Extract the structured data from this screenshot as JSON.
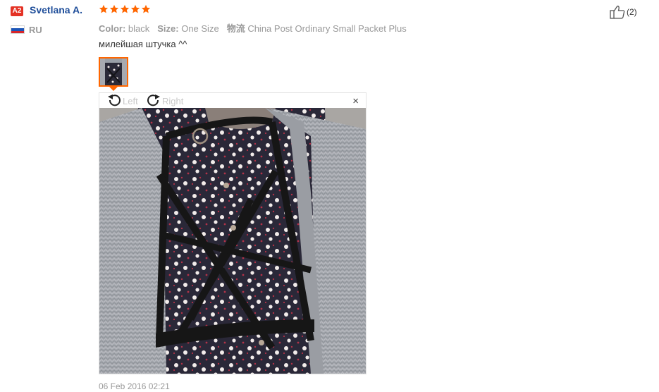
{
  "user": {
    "level_badge": "A2",
    "name": "Svetlana A.",
    "country_code": "RU",
    "flag_colors": [
      "#ffffff",
      "#1c56b8",
      "#d7262b"
    ]
  },
  "feedback": {
    "rating": 5,
    "max_rating": 5,
    "star_color": "#ff6600",
    "attributes": [
      {
        "key": "Color:",
        "value": "black"
      },
      {
        "key": "Size:",
        "value": "One Size"
      },
      {
        "key": "物流",
        "value": "China Post Ordinary Small Packet Plus"
      }
    ],
    "comment": "милейшая штучка ^^",
    "date": "06 Feb 2016 02:21"
  },
  "viewer": {
    "rotate_left_label": "Left",
    "rotate_right_label": "Right",
    "close_glyph": "×"
  },
  "helpful": {
    "count_label": "(2)"
  },
  "colors": {
    "accent": "#ff6600",
    "username": "#1f4e9a",
    "badge": "#e43225"
  }
}
